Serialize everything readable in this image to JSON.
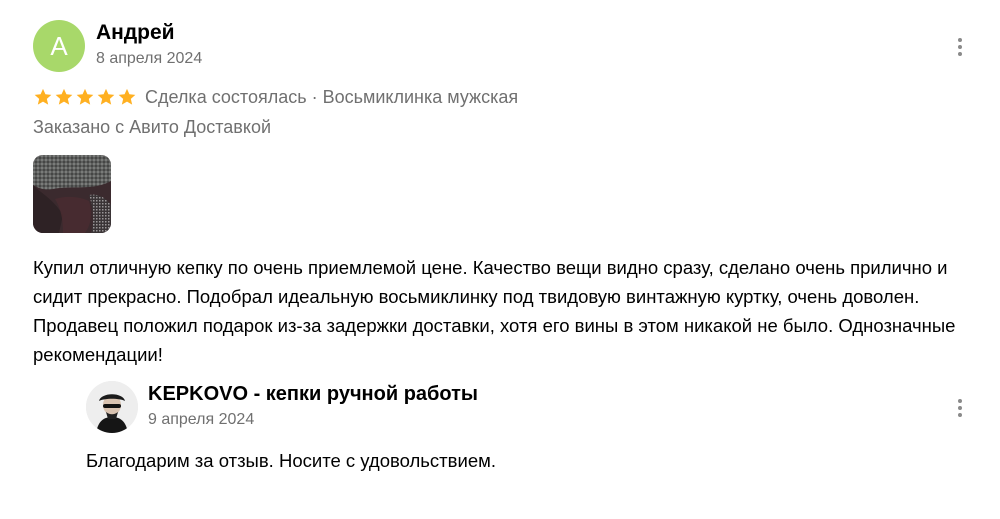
{
  "review": {
    "avatar_letter": "А",
    "author": "Андрей",
    "date": "8 апреля 2024",
    "rating": 5,
    "rating_max": 5,
    "deal_info": "Сделка состоялась · Восьмиклинка мужская",
    "delivery_note": "Заказано с Авито Доставкой",
    "text": "Купил отличную кепку по очень приемлемой цене. Качество вещи видно сразу, сделано очень прилично и сидит прекрасно. Подобрал идеальную восьмиклинку под твидовую винтажную куртку, очень доволен. Продавец положил подарок из-за задержки доставки, хотя его вины в этом никакой не было. Однозначные рекомендации!"
  },
  "reply": {
    "author": "KEPKOVO - кепки ручной работы",
    "date": "9 апреля 2024",
    "text": "Благодарим за отзыв. Носите с удовольствием."
  },
  "colors": {
    "avatar_bg": "#a8d86a",
    "star": "#ffb021",
    "secondary_text": "#707070",
    "more_dots": "#8a8a8a"
  },
  "icons": {
    "more": "more-vertical-icon",
    "star": "star-icon"
  }
}
